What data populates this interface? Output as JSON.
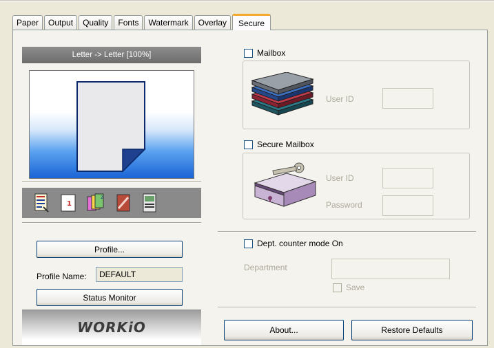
{
  "tabs": [
    {
      "label": "Paper",
      "active": false
    },
    {
      "label": "Output",
      "active": false
    },
    {
      "label": "Quality",
      "active": false
    },
    {
      "label": "Fonts",
      "active": false
    },
    {
      "label": "Watermark",
      "active": false
    },
    {
      "label": "Overlay",
      "active": false
    },
    {
      "label": "Secure",
      "active": true
    }
  ],
  "preview": {
    "title": "Letter -> Letter [100%]",
    "icons": [
      "document-lines-icon",
      "page-number-icon",
      "collate-icon",
      "stamp-icon",
      "booklet-icon"
    ]
  },
  "left": {
    "profile_button": "Profile...",
    "profile_name_label": "Profile Name:",
    "profile_name_value": "DEFAULT",
    "status_monitor_button": "Status Monitor",
    "brand": "WORKiO"
  },
  "secure": {
    "mailbox": {
      "label": "Mailbox",
      "checked": false,
      "user_id_label": "User ID"
    },
    "secure_mailbox": {
      "label": "Secure Mailbox",
      "checked": false,
      "user_id_label": "User ID",
      "password_label": "Password"
    },
    "dept_counter": {
      "label": "Dept. counter mode On",
      "checked": false,
      "department_label": "Department",
      "save_label": "Save"
    }
  },
  "buttons": {
    "about": "About...",
    "restore": "Restore Defaults"
  },
  "colors": {
    "active_tab_accent": "#f3a92e",
    "preview_blue": "#1a64d6"
  }
}
